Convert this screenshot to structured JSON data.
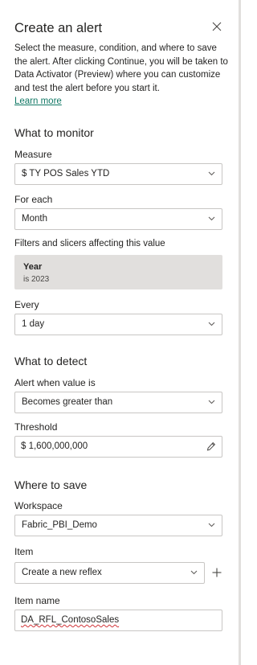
{
  "panel": {
    "title": "Create an alert",
    "description": "Select the measure, condition, and where to save the alert. After clicking Continue, you will be taken to Data Activator (Preview) where you can customize and test the alert before you start it.",
    "learn_more": "Learn more"
  },
  "monitor": {
    "heading": "What to monitor",
    "measure_label": "Measure",
    "measure_value": "$ TY POS Sales YTD",
    "for_each_label": "For each",
    "for_each_value": "Month",
    "filters_label": "Filters and slicers affecting this value",
    "filter": {
      "name": "Year",
      "value": "is 2023"
    },
    "every_label": "Every",
    "every_value": "1 day"
  },
  "detect": {
    "heading": "What to detect",
    "alert_label": "Alert when value is",
    "alert_value": "Becomes greater than",
    "threshold_label": "Threshold",
    "threshold_value": "$ 1,600,000,000"
  },
  "save": {
    "heading": "Where to save",
    "workspace_label": "Workspace",
    "workspace_value": "Fabric_PBI_Demo",
    "item_label": "Item",
    "item_value": "Create a new reflex",
    "item_name_label": "Item name",
    "item_name_value": "DA_RFL_ContosoSales"
  },
  "icons": {
    "close": "close-icon",
    "chevron": "chevron-down-icon",
    "pencil": "pencil-icon",
    "plus": "plus-icon"
  },
  "colors": {
    "link": "#117865",
    "filter_card_bg": "#e1dfdd",
    "border": "#c8c6c4",
    "text": "#252423",
    "spellcheck": "#d13438"
  }
}
